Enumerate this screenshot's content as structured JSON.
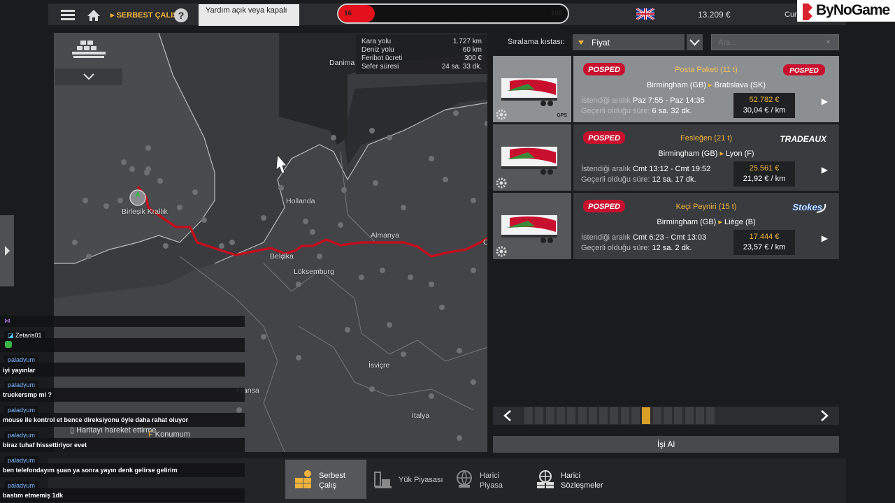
{
  "topbar": {
    "crumb": "SERBEST ÇALIŞ",
    "help_tip": "Yardım açık veya kapalı",
    "follow_current": "16",
    "follow_label": "TAKİP ETMEYEN GAY",
    "follow_goal": "100",
    "follow_progress": 0.16,
    "money": "13.209 €",
    "user_cut": "Cum",
    "watermark": "ByNoGame"
  },
  "map_info": {
    "rows": [
      {
        "label": "Kara yolu",
        "value": "1.727 km"
      },
      {
        "label": "Deniz yolu",
        "value": "60 km"
      },
      {
        "label": "Feribot ücreti",
        "value": "300 €"
      },
      {
        "label": "Sefer süresi",
        "value": "24 sa. 33 dk."
      }
    ]
  },
  "map_labels": {
    "danimarka": "Danima",
    "uk": "Birleşik Krallık",
    "hollanda": "Hollanda",
    "almanya": "Almanya",
    "belcika": "Belçika",
    "luksemburg": "Lüksemburg",
    "isvicre": "İsviçre",
    "fransa": "Fransa",
    "italya": "İtalya",
    "edge_c": "C"
  },
  "map_hints": {
    "move": "Haritayı hareket ettirme",
    "pos_key": "F",
    "pos": "Konumum"
  },
  "sort": {
    "label": "Sıralama kıstası:",
    "value": "Fiyat",
    "search_placeholder": "Ara..."
  },
  "jobs": [
    {
      "title": "Posta Paketi (11 t)",
      "route_from": "Birmingham (GB)",
      "route_to": "Bratislava (SK)",
      "window_label": "İstendiği aralık",
      "window": "Paz 7:55 - Paz 14:35",
      "valid_label": "Geçerli olduğu süre:",
      "valid": "6 sa. 32 dk.",
      "price": "52.782 €",
      "rate": "30,04 € / km",
      "company": "POSPED",
      "gps": "GPS"
    },
    {
      "title": "Fesleğen (21 t)",
      "route_from": "Birmingham (GB)",
      "route_to": "Lyon (F)",
      "window_label": "İstendiği aralık",
      "window": "Cmt 13:12 - Cmt 19:52",
      "valid_label": "Geçerli olduğu süre:",
      "valid": "12 sa. 17 dk.",
      "price": "25.561 €",
      "rate": "21,92 € / km",
      "company": "TRADEAUX"
    },
    {
      "title": "Keçi Peyniri (15 t)",
      "route_from": "Birmingham (GB)",
      "route_to": "Liège (B)",
      "window_label": "İstendiği aralık",
      "window": "Cmt 6:23 - Cmt 13:03",
      "valid_label": "Geçerli olduğu süre:",
      "valid": "12 sa. 2 dk.",
      "price": "17.444 €",
      "rate": "23,57 € / km",
      "company": "Stokes"
    }
  ],
  "pager": {
    "pages": 18,
    "current": 11
  },
  "accept_label": "İşi Al",
  "tabs": [
    {
      "label": "Serbest Çalış"
    },
    {
      "label": "Yük Piyasası"
    },
    {
      "label": "Harici Piyasa"
    },
    {
      "label": "Harici Sözleşmeler"
    }
  ],
  "chat": {
    "users": [
      "Zetaris01",
      "paladyum",
      "paladyum",
      "paladyum",
      "paladyum",
      "paladyum",
      "paladyum"
    ],
    "messages": [
      "iyi yayınlar",
      "truckersmp mi ?",
      "mouse ile kontrol et bence direksiyonu öyle daha rahat oluyor",
      "biraz tuhaf hissettiriyor evet",
      "ben telefondayım şuan ya sonra yayın denk gelirse gelirim",
      "bastım etmemiş 1dk"
    ]
  },
  "colors": {
    "accent": "#f0b43c",
    "route": "#c01020",
    "progress": "#e4101b"
  }
}
